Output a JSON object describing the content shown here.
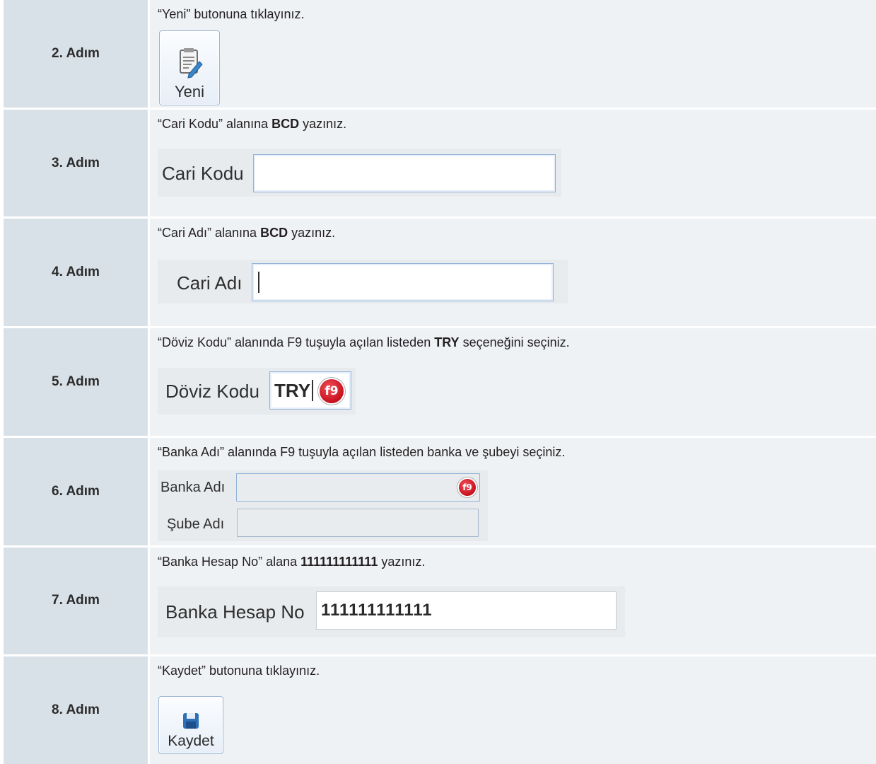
{
  "steps": [
    {
      "label": "2. Adım",
      "instruction": {
        "pre": "“Yeni” butonuna tıklayınız.",
        "bold": "",
        "post": ""
      },
      "button": {
        "label": "Yeni",
        "icon": "document-edit-icon"
      }
    },
    {
      "label": "3. Adım",
      "instruction": {
        "pre": "“Cari Kodu” alanına ",
        "bold": "BCD",
        "post": " yazınız."
      },
      "field": {
        "label": "Cari Kodu",
        "value": ""
      }
    },
    {
      "label": "4. Adım",
      "instruction": {
        "pre": "“Cari Adı” alanına ",
        "bold": "BCD",
        "post": " yazınız."
      },
      "field": {
        "label": "Cari Adı",
        "value": ""
      }
    },
    {
      "label": "5. Adım",
      "instruction": {
        "pre": "“Döviz Kodu” alanında F9 tuşuyla açılan listeden ",
        "bold": "TRY",
        "post": " seçeneğini seçiniz."
      },
      "field": {
        "label": "Döviz Kodu",
        "value": "TRY",
        "f9": "f9"
      }
    },
    {
      "label": "6. Adım",
      "instruction": {
        "pre": "“Banka Adı” alanında F9 tuşuyla açılan listeden banka ve şubeyi seçiniz.",
        "bold": "",
        "post": ""
      },
      "fields": [
        {
          "label": "Banka Adı",
          "value": "",
          "f9": "f9"
        },
        {
          "label": "Şube Adı",
          "value": ""
        }
      ]
    },
    {
      "label": "7. Adım",
      "instruction": {
        "pre": "“Banka Hesap No” alana ",
        "bold": "111111111111",
        "post": " yazınız."
      },
      "field": {
        "label": "Banka Hesap No",
        "value": "111111111111"
      }
    },
    {
      "label": "8. Adım",
      "instruction": {
        "pre": "“Kaydet” butonuna tıklayınız.",
        "bold": "",
        "post": ""
      },
      "button": {
        "label": "Kaydet",
        "icon": "floppy-disk-icon"
      }
    }
  ],
  "colors": {
    "label_bg": "#d9e1e8",
    "content_bg": "#eff2f5",
    "f9_red": "#c8101e",
    "field_border": "#93b3d8"
  }
}
